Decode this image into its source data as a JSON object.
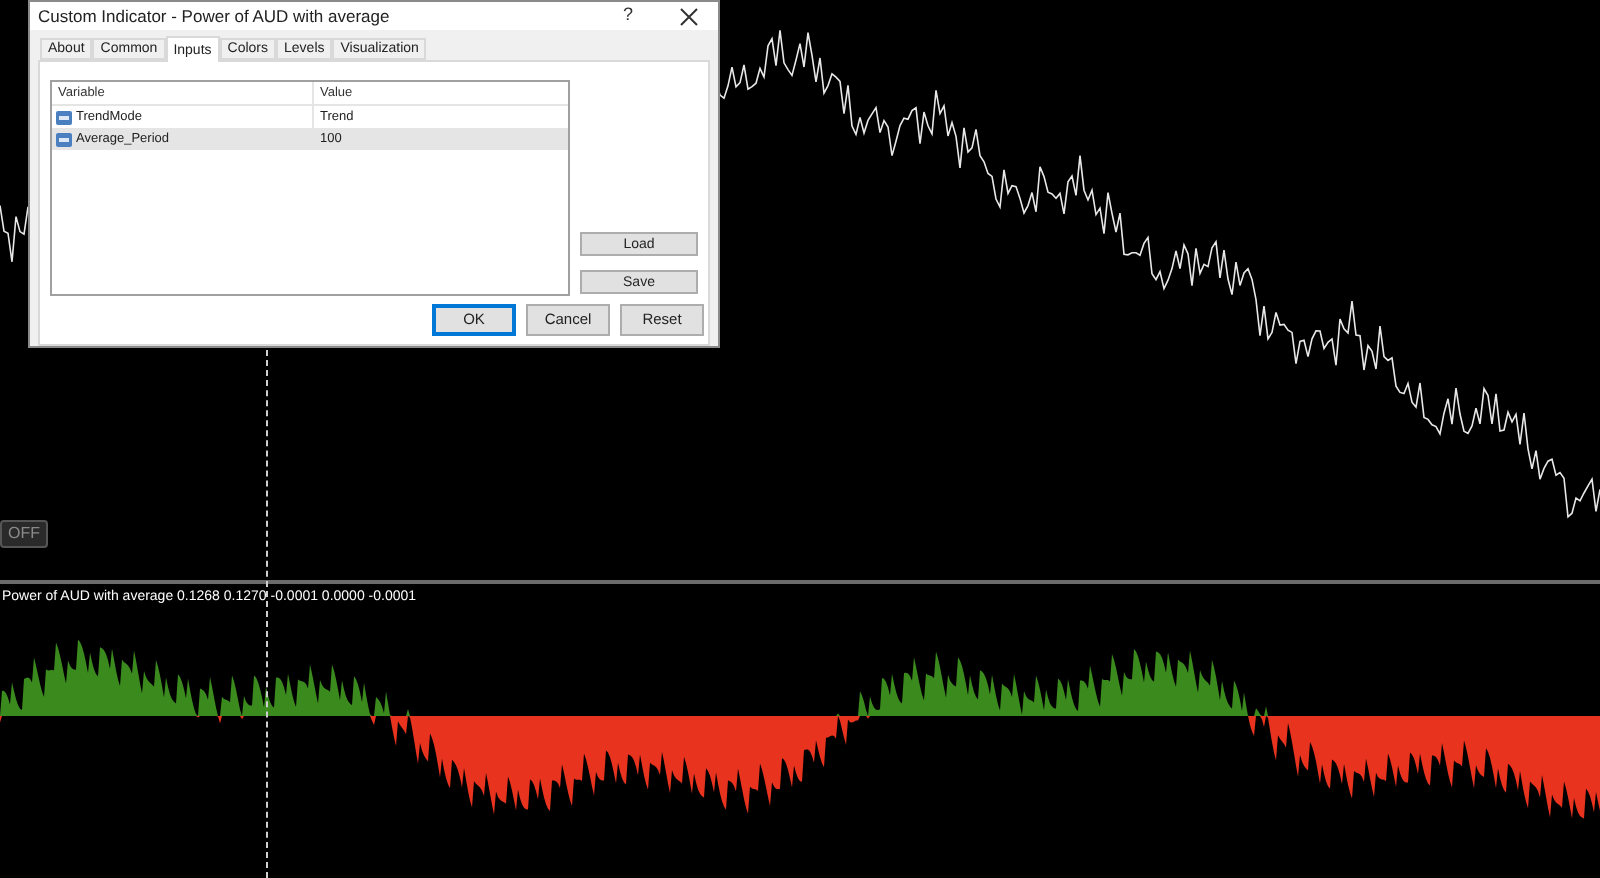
{
  "dialog": {
    "title": "Custom Indicator - Power of AUD with average",
    "help": "?",
    "tabs": [
      {
        "label": "About",
        "selected": false
      },
      {
        "label": "Common",
        "selected": false
      },
      {
        "label": "Inputs",
        "selected": true
      },
      {
        "label": "Colors",
        "selected": false
      },
      {
        "label": "Levels",
        "selected": false
      },
      {
        "label": "Visualization",
        "selected": false
      }
    ],
    "table": {
      "columns": [
        "Variable",
        "Value"
      ],
      "rows": [
        {
          "variable": "TrendMode",
          "value": "Trend",
          "selected": false
        },
        {
          "variable": "Average_Period",
          "value": "100",
          "selected": true
        }
      ]
    },
    "side_buttons": [
      "Load",
      "Save"
    ],
    "buttons": [
      {
        "label": "OK",
        "default": true
      },
      {
        "label": "Cancel",
        "default": false
      },
      {
        "label": "Reset",
        "default": false
      }
    ]
  },
  "chart": {
    "off_button": "OFF",
    "indicator_label": "Power of AUD with average 0.1268 0.1270 -0.0001 0.0000 -0.0001"
  }
}
